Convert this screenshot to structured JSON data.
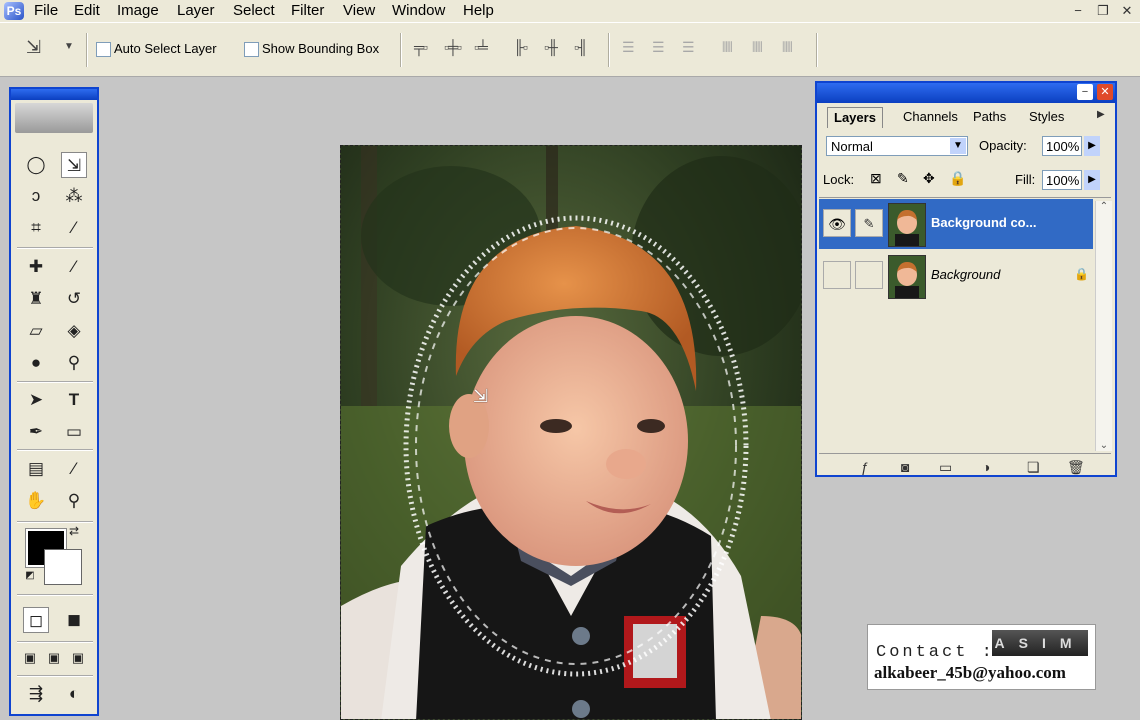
{
  "menubar": {
    "items": [
      "File",
      "Edit",
      "Image",
      "Layer",
      "Select",
      "Filter",
      "View",
      "Window",
      "Help"
    ],
    "window_buttons": [
      "−",
      "❐",
      "✕"
    ]
  },
  "options_bar": {
    "auto_select_label": "Auto Select Layer",
    "show_bounding_label": "Show Bounding Box",
    "auto_select_checked": false,
    "show_bounding_checked": false
  },
  "toolbox": {
    "foreground_color": "#000000",
    "background_color": "#ffffff",
    "active_tool": "move-tool"
  },
  "layers_panel": {
    "tabs": [
      "Layers",
      "Channels",
      "Paths",
      "Styles"
    ],
    "active_tab": "Layers",
    "blend_mode": "Normal",
    "opacity_label": "Opacity:",
    "opacity_value": "100%",
    "lock_label": "Lock:",
    "fill_label": "Fill:",
    "fill_value": "100%",
    "layers": [
      {
        "name": "Background co...",
        "selected": true,
        "visible": true
      },
      {
        "name": "Background",
        "selected": false,
        "visible": false,
        "locked": true
      }
    ]
  },
  "watermark": {
    "contact_label": "Contact :",
    "brand": "ASIM",
    "email": "alkabeer_45b@yahoo.com"
  },
  "colors": {
    "window_chrome": "#ece9d8",
    "titlebar_blue": "#0f44d0",
    "selection_blue": "#316ac5",
    "workspace_gray": "#c6c6c6"
  }
}
